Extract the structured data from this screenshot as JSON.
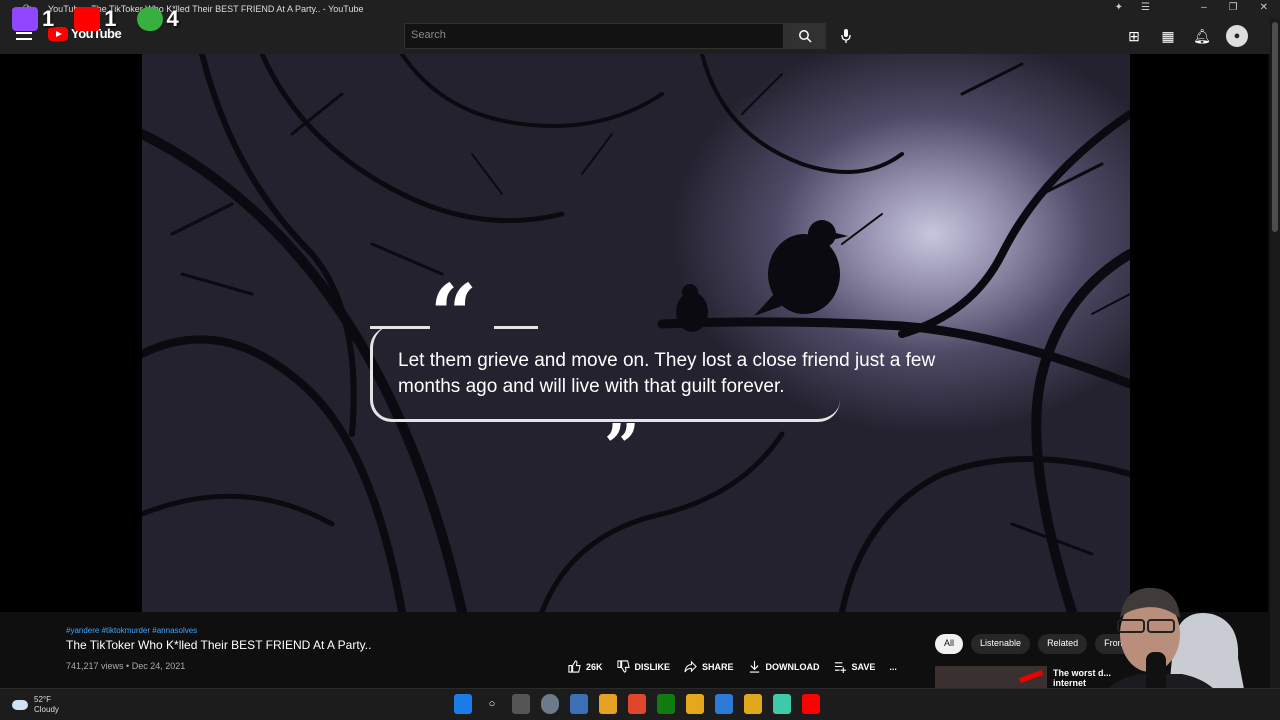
{
  "window": {
    "title": "YouTube - The TikToker Who K*lled Their BEST FRIEND At A Party.. - YouTube"
  },
  "overlay": {
    "counters": [
      {
        "icon": "twitch-icon",
        "value": "1",
        "color": "#9146ff"
      },
      {
        "icon": "youtube-icon",
        "value": "1",
        "color": "#ff0000"
      },
      {
        "icon": "rumble-icon",
        "value": "4",
        "color": "#38b040"
      }
    ]
  },
  "header": {
    "logo_text": "YouTube",
    "search_placeholder": "Search",
    "icons": [
      "create-icon",
      "apps-icon",
      "bell-icon",
      "avatar"
    ]
  },
  "video": {
    "quote_text": "Let them grieve and move on. They lost a close friend just a few months ago and will live with that guilt forever.",
    "open_quote": "“",
    "close_quote": "”"
  },
  "info": {
    "hashtags": "#yandere #tiktokmurder #annasolves",
    "title": "The TikToker Who K*lled Their BEST FRIEND At A Party..",
    "meta": "741,217 views • Dec 24, 2021"
  },
  "actions": {
    "like": "26K",
    "dislike": "DISLIKE",
    "share": "SHARE",
    "download": "DOWNLOAD",
    "save": "SAVE",
    "more": "..."
  },
  "chips": [
    "All",
    "Listenable",
    "Related",
    "From"
  ],
  "recommendation": {
    "title": "The worst d... internet"
  },
  "taskbar": {
    "temperature": "52°F",
    "condition": "Cloudy"
  }
}
